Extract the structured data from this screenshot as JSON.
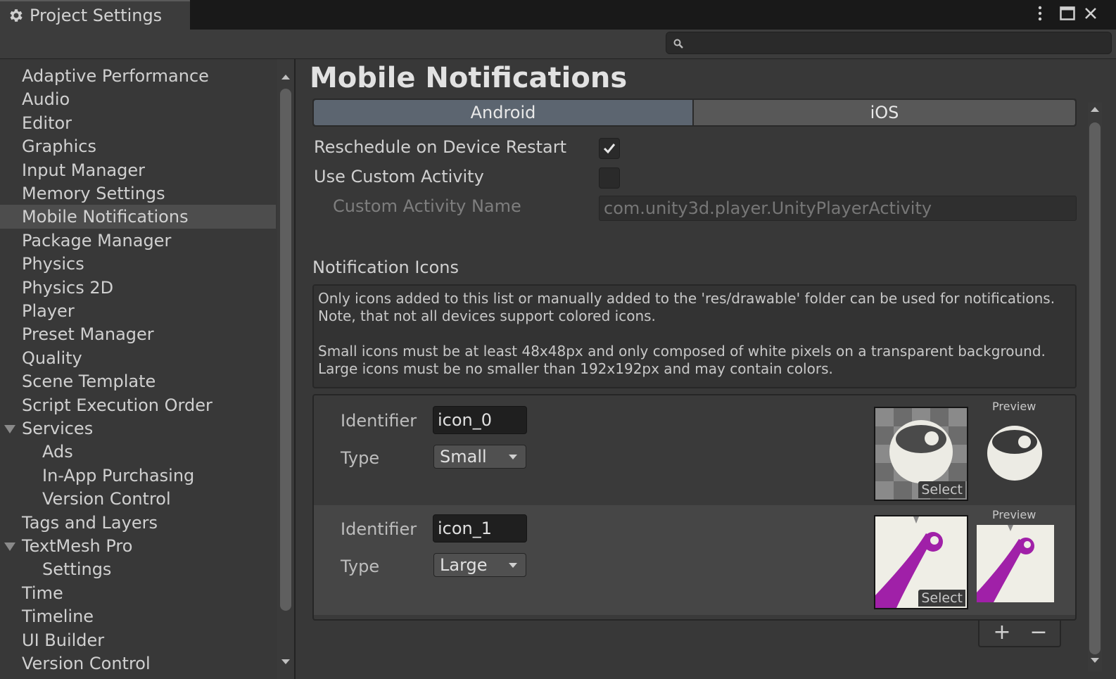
{
  "window": {
    "tab_title": "Project Settings",
    "controls": [
      "kebab-menu-icon",
      "maximize-icon",
      "close-icon"
    ]
  },
  "search": {
    "placeholder": "",
    "value": ""
  },
  "sidebar": {
    "selected": "Mobile Notifications",
    "items": [
      {
        "label": "Adaptive Performance",
        "level": 0
      },
      {
        "label": "Audio",
        "level": 0
      },
      {
        "label": "Editor",
        "level": 0
      },
      {
        "label": "Graphics",
        "level": 0
      },
      {
        "label": "Input Manager",
        "level": 0
      },
      {
        "label": "Memory Settings",
        "level": 0
      },
      {
        "label": "Mobile Notifications",
        "level": 0
      },
      {
        "label": "Package Manager",
        "level": 0
      },
      {
        "label": "Physics",
        "level": 0
      },
      {
        "label": "Physics 2D",
        "level": 0
      },
      {
        "label": "Player",
        "level": 0
      },
      {
        "label": "Preset Manager",
        "level": 0
      },
      {
        "label": "Quality",
        "level": 0
      },
      {
        "label": "Scene Template",
        "level": 0
      },
      {
        "label": "Script Execution Order",
        "level": 0
      },
      {
        "label": "Services",
        "level": 0,
        "expanded": true
      },
      {
        "label": "Ads",
        "level": 1
      },
      {
        "label": "In-App Purchasing",
        "level": 1
      },
      {
        "label": "Version Control",
        "level": 1
      },
      {
        "label": "Tags and Layers",
        "level": 0
      },
      {
        "label": "TextMesh Pro",
        "level": 0,
        "expanded": true
      },
      {
        "label": "Settings",
        "level": 1
      },
      {
        "label": "Time",
        "level": 0
      },
      {
        "label": "Timeline",
        "level": 0
      },
      {
        "label": "UI Builder",
        "level": 0
      },
      {
        "label": "Version Control",
        "level": 0
      }
    ]
  },
  "main": {
    "title": "Mobile Notifications",
    "tabs": [
      {
        "label": "Android",
        "active": true
      },
      {
        "label": "iOS",
        "active": false
      }
    ],
    "fields": {
      "reschedule_label": "Reschedule on Device Restart",
      "reschedule_checked": true,
      "custom_activity_label": "Use Custom Activity",
      "custom_activity_checked": false,
      "activity_name_label": "Custom Activity Name",
      "activity_name_value": "com.unity3d.player.UnityPlayerActivity"
    },
    "icons_section": {
      "label": "Notification Icons",
      "help_lines": [
        "Only icons added to this list or manually added to the 'res/drawable' folder can be used for notifications.",
        "Note, that not all devices support colored icons.",
        "Small icons must be at least 48x48px and only composed of white pixels on a transparent background.",
        "Large icons must be no smaller than 192x192px and may contain colors."
      ],
      "rows": [
        {
          "identifier_label": "Identifier",
          "identifier": "icon_0",
          "type_label": "Type",
          "type": "Small",
          "select_label": "Select",
          "preview_label": "Preview",
          "icon": "eye-ball-icon"
        },
        {
          "identifier_label": "Identifier",
          "identifier": "icon_1",
          "type_label": "Type",
          "type": "Large",
          "select_label": "Select",
          "preview_label": "Preview",
          "icon": "purple-stroke-icon"
        }
      ],
      "add_label": "+",
      "remove_label": "−"
    }
  },
  "colors": {
    "background": "#383838",
    "active_tab": "#5c6570",
    "large_icon_purple": "#a020a8"
  }
}
